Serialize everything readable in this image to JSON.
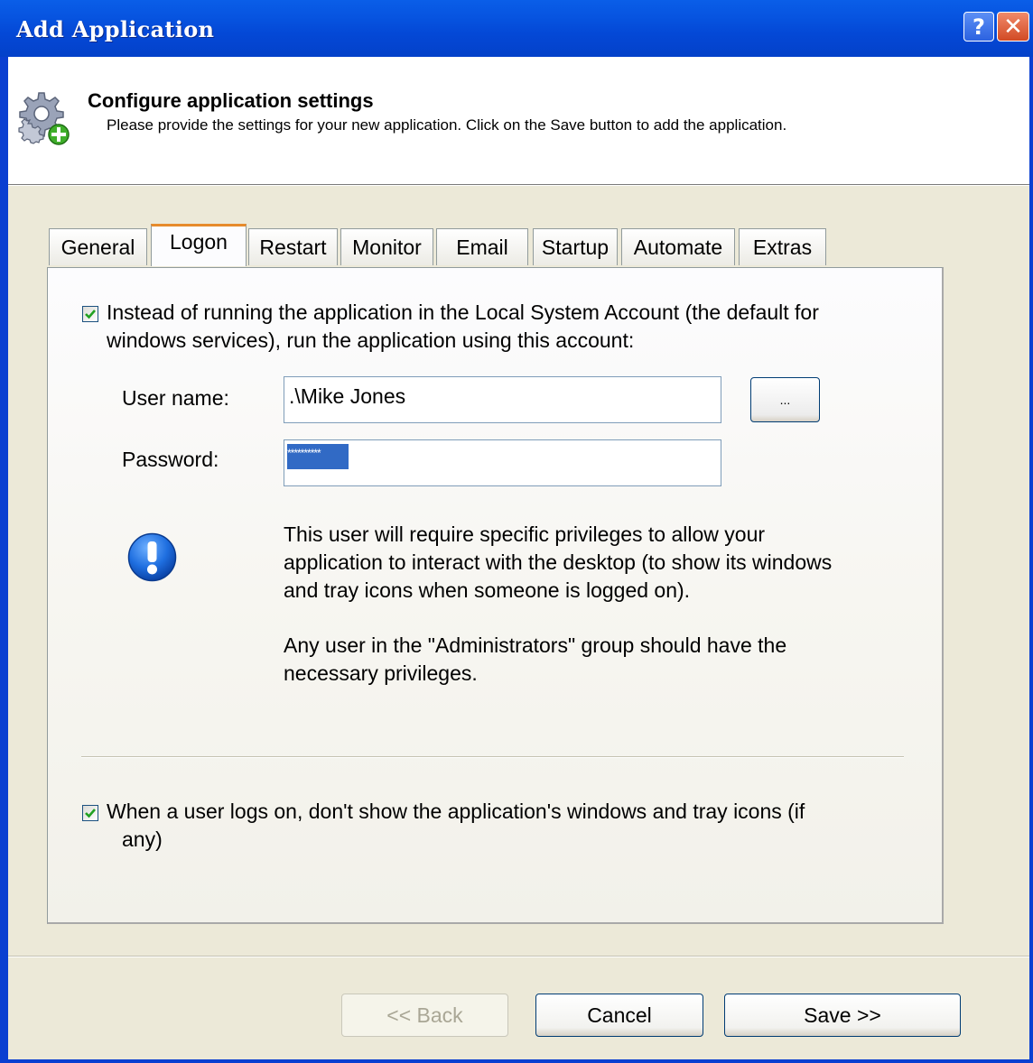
{
  "window": {
    "title": "Add Application",
    "help_label": "?",
    "close_label": "✕"
  },
  "header": {
    "title": "Configure application settings",
    "subtitle": "Please provide the settings for your new application. Click on the Save button to add the application.",
    "icon": "gear-add-icon"
  },
  "tabs": [
    {
      "label": "General"
    },
    {
      "label": "Logon",
      "active": true
    },
    {
      "label": "Restart"
    },
    {
      "label": "Monitor"
    },
    {
      "label": "Email"
    },
    {
      "label": "Startup"
    },
    {
      "label": "Automate"
    },
    {
      "label": "Extras"
    }
  ],
  "logon": {
    "run_as_checked": true,
    "run_as_line1": "Instead of running the application in the Local System Account (the default for",
    "run_as_line2": "windows services), run the application using this account:",
    "username_label": "User name:",
    "username_value": ".\\Mike Jones",
    "browse_label": "...",
    "password_label": "Password:",
    "password_mask": "**********",
    "info_icon": "exclamation-info-icon",
    "info_line1": "This user will require specific privileges to allow your",
    "info_line2": "application to interact with the desktop (to show its windows",
    "info_line3": "and tray icons when someone is logged on).",
    "info_line4": "Any user in the \"Administrators\" group should have the",
    "info_line5": "necessary privileges.",
    "hide_checked": true,
    "hide_line1": "When a user logs on, don't show the application's windows and tray icons (if",
    "hide_line2": "any)"
  },
  "buttons": {
    "back": "<< Back",
    "cancel": "Cancel",
    "save": "Save >>"
  },
  "colors": {
    "titlebar": "#0a5ee8",
    "active_tab_accent": "#e68b2c",
    "selection": "#316ac5",
    "dialog_bg": "#ece9d8"
  }
}
